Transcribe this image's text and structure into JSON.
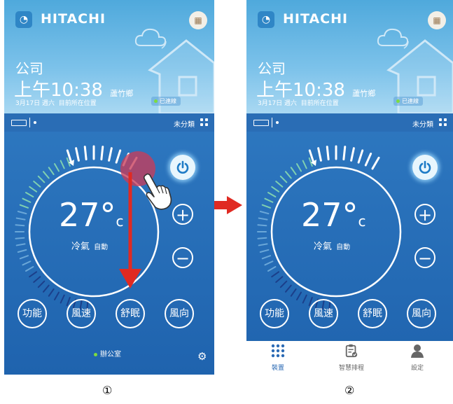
{
  "colors": {
    "header_blue": "#4fa9dc",
    "panel_blue": "#2e78c0",
    "accent_red": "#e02a22",
    "power_blue": "#1d7bc6"
  },
  "screen1": {
    "header": {
      "brand": "HITACHI",
      "location": "公司",
      "time": "上午10:38",
      "place": "蘆竹鄉",
      "date": "3月17日 週六",
      "date_note": "目前所在位置",
      "status": "已連線"
    },
    "topbar": {
      "group": "未分類"
    },
    "thermostat": {
      "temperature": "27°",
      "unit": "c",
      "mode": "冷氣",
      "fan": "自動"
    },
    "buttons": {
      "plus": "+",
      "minus": "−"
    },
    "functions": [
      "功能",
      "風速",
      "舒眠",
      "風向"
    ],
    "room": "辦公室"
  },
  "screen2": {
    "header": {
      "brand": "HITACHI",
      "location": "公司",
      "time": "上午10:38",
      "place": "蘆竹鄉",
      "date": "3月17日 週六",
      "date_note": "目前所在位置",
      "status": "已連線"
    },
    "topbar": {
      "group": "未分類"
    },
    "thermostat": {
      "temperature": "27°",
      "unit": "c",
      "mode": "冷氣",
      "fan": "自動"
    },
    "buttons": {
      "plus": "+",
      "minus": "−"
    },
    "functions": [
      "功能",
      "風速",
      "舒眠",
      "風向"
    ],
    "nav": [
      "裝置",
      "智慧排程",
      "設定"
    ]
  },
  "steps": [
    "①",
    "②"
  ],
  "icons": [
    "wifi-logo-icon",
    "calendar-icon",
    "house-icon",
    "cloud-icon",
    "power-icon",
    "plus-icon",
    "minus-icon",
    "gear-icon",
    "grid-icon",
    "schedule-icon",
    "user-icon",
    "hand-pointer-icon"
  ]
}
